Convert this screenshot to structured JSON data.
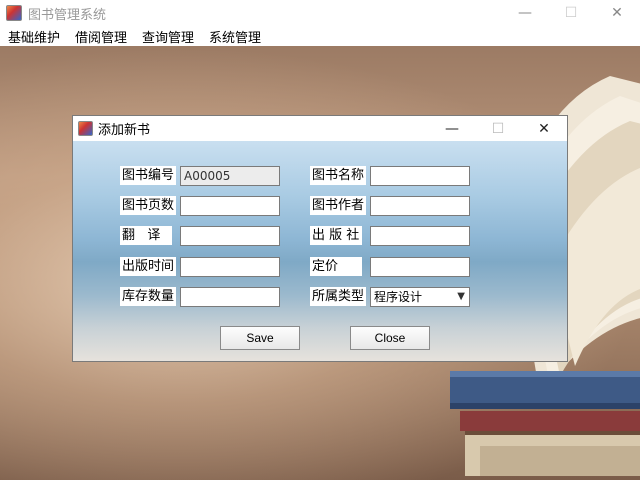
{
  "window": {
    "title": "图书管理系统",
    "controls": {
      "minimize": "—",
      "maximize": "☐",
      "close": "✕"
    }
  },
  "menubar": {
    "items": [
      {
        "label": "基础维护"
      },
      {
        "label": "借阅管理"
      },
      {
        "label": "查询管理"
      },
      {
        "label": "系统管理"
      }
    ]
  },
  "dialog": {
    "title": "添加新书",
    "controls": {
      "minimize": "—",
      "maximize": "☐",
      "close": "✕"
    },
    "fields": {
      "book_id": {
        "label": "图书编号",
        "value": "A00005"
      },
      "book_name": {
        "label": "图书名称",
        "value": ""
      },
      "pages": {
        "label": "图书页数",
        "value": ""
      },
      "author": {
        "label": "图书作者",
        "value": ""
      },
      "translator": {
        "label": "翻   译",
        "value": ""
      },
      "publisher": {
        "label": "出 版 社",
        "value": ""
      },
      "pub_time": {
        "label": "出版时间",
        "value": ""
      },
      "price": {
        "label": "定价",
        "value": ""
      },
      "stock": {
        "label": "库存数量",
        "value": ""
      },
      "category": {
        "label": "所属类型",
        "value": "程序设计"
      }
    },
    "buttons": {
      "save": "Save",
      "close": "Close"
    }
  }
}
